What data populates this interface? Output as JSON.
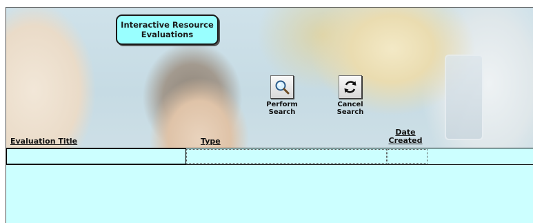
{
  "header": {
    "title": "Interactive Resource\nEvaluations"
  },
  "toolbar": {
    "perform_search_label": "Perform\nSearch",
    "perform_search_icon": "magnifier-icon",
    "cancel_search_label": "Cancel\nSearch",
    "cancel_search_icon": "refresh-icon"
  },
  "columns": {
    "evaluation_title": "Evaluation Title",
    "type": "Type",
    "date_created": "Date\nCreated"
  },
  "search_row": {
    "evaluation_title_value": "",
    "type_value": "",
    "date_created_value": ""
  },
  "colors": {
    "badge_fill": "#99ffff",
    "grid_fill": "#ccffff"
  }
}
